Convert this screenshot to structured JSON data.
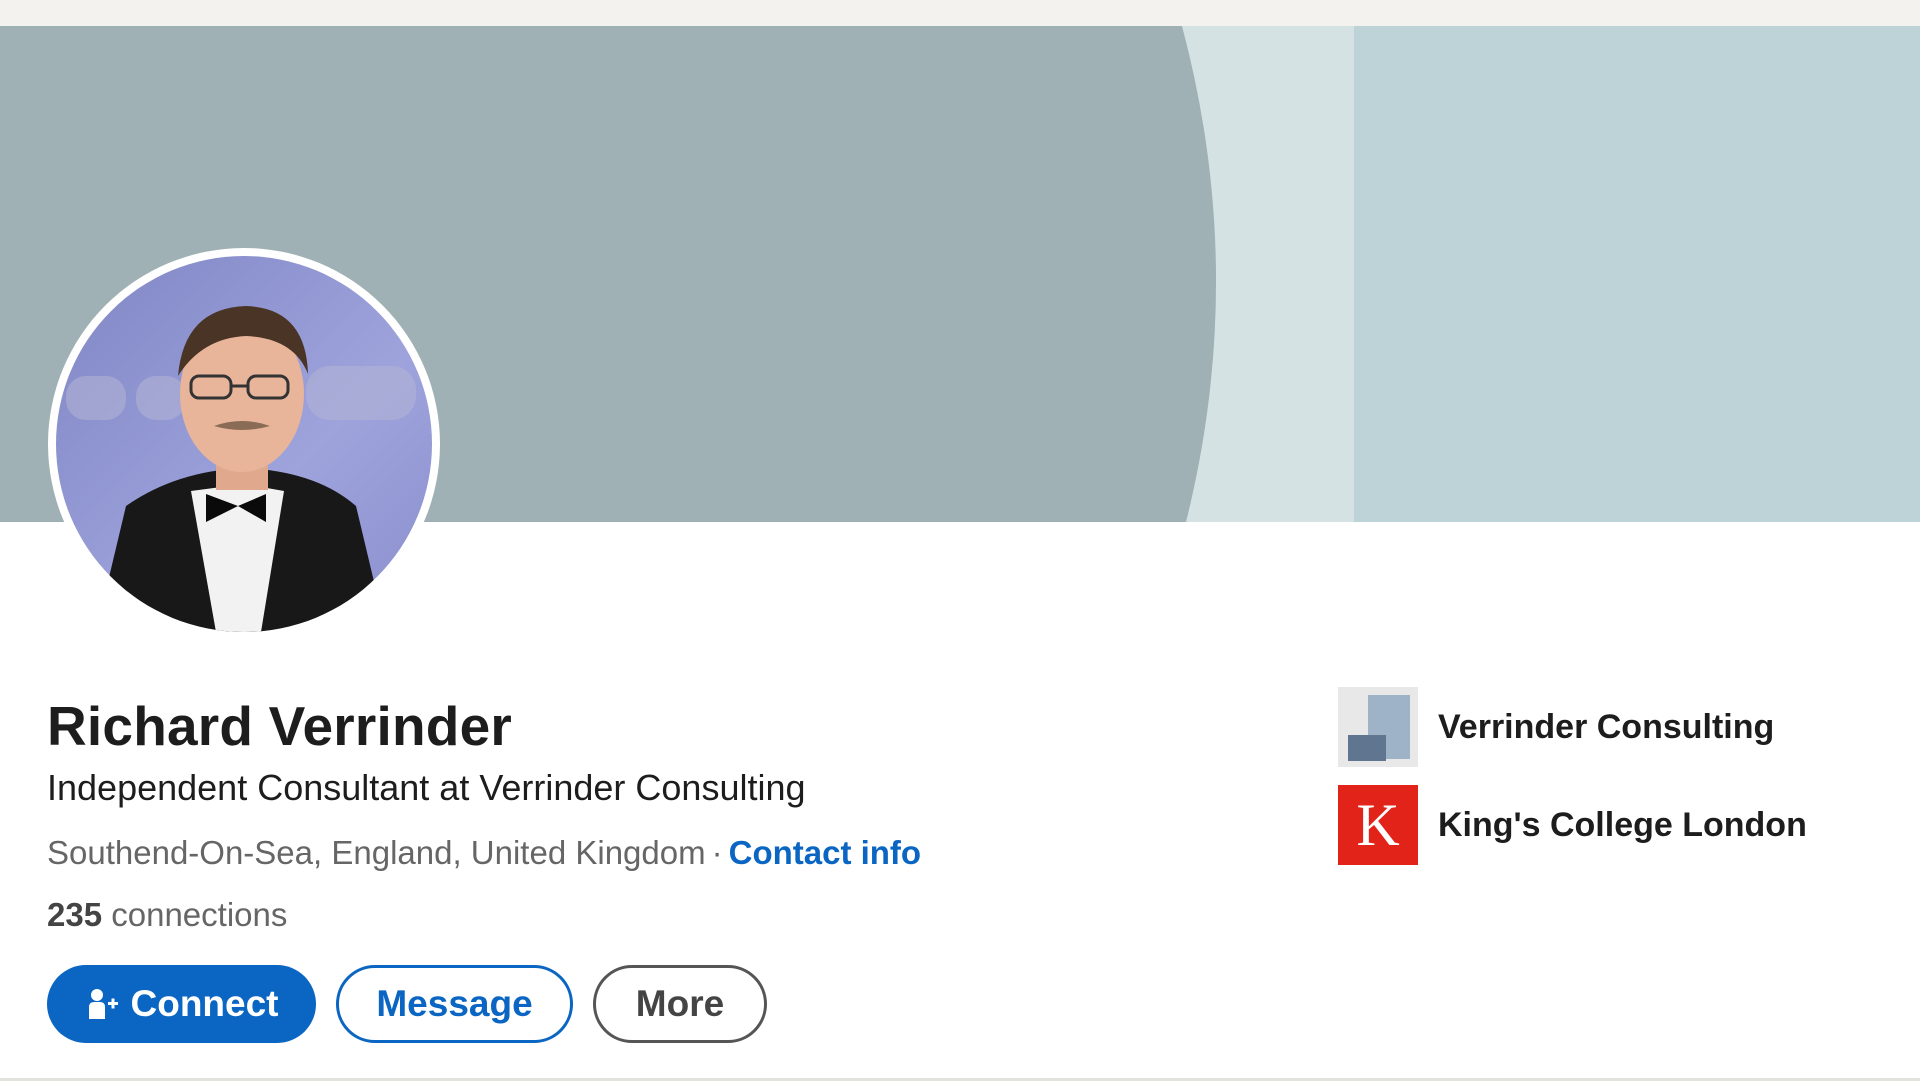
{
  "profile": {
    "name": "Richard Verrinder",
    "headline": "Independent Consultant at Verrinder Consulting",
    "location": "Southend-On-Sea, England, United Kingdom",
    "separator": "·",
    "contact_label": "Contact info",
    "connections_count": "235",
    "connections_label": "connections"
  },
  "actions": {
    "connect_label": "Connect",
    "message_label": "Message",
    "more_label": "More"
  },
  "organizations": [
    {
      "name": "Verrinder Consulting",
      "icon": "company-logo"
    },
    {
      "name": "King's College London",
      "icon": "kcl-logo",
      "logo_letter": "K"
    }
  ],
  "colors": {
    "accent": "#0a66c2",
    "banner_main": "#9fb1b4",
    "banner_light": "#d4e2e4",
    "banner_right": "#bed3d7",
    "kcl_red": "#e2231a"
  }
}
